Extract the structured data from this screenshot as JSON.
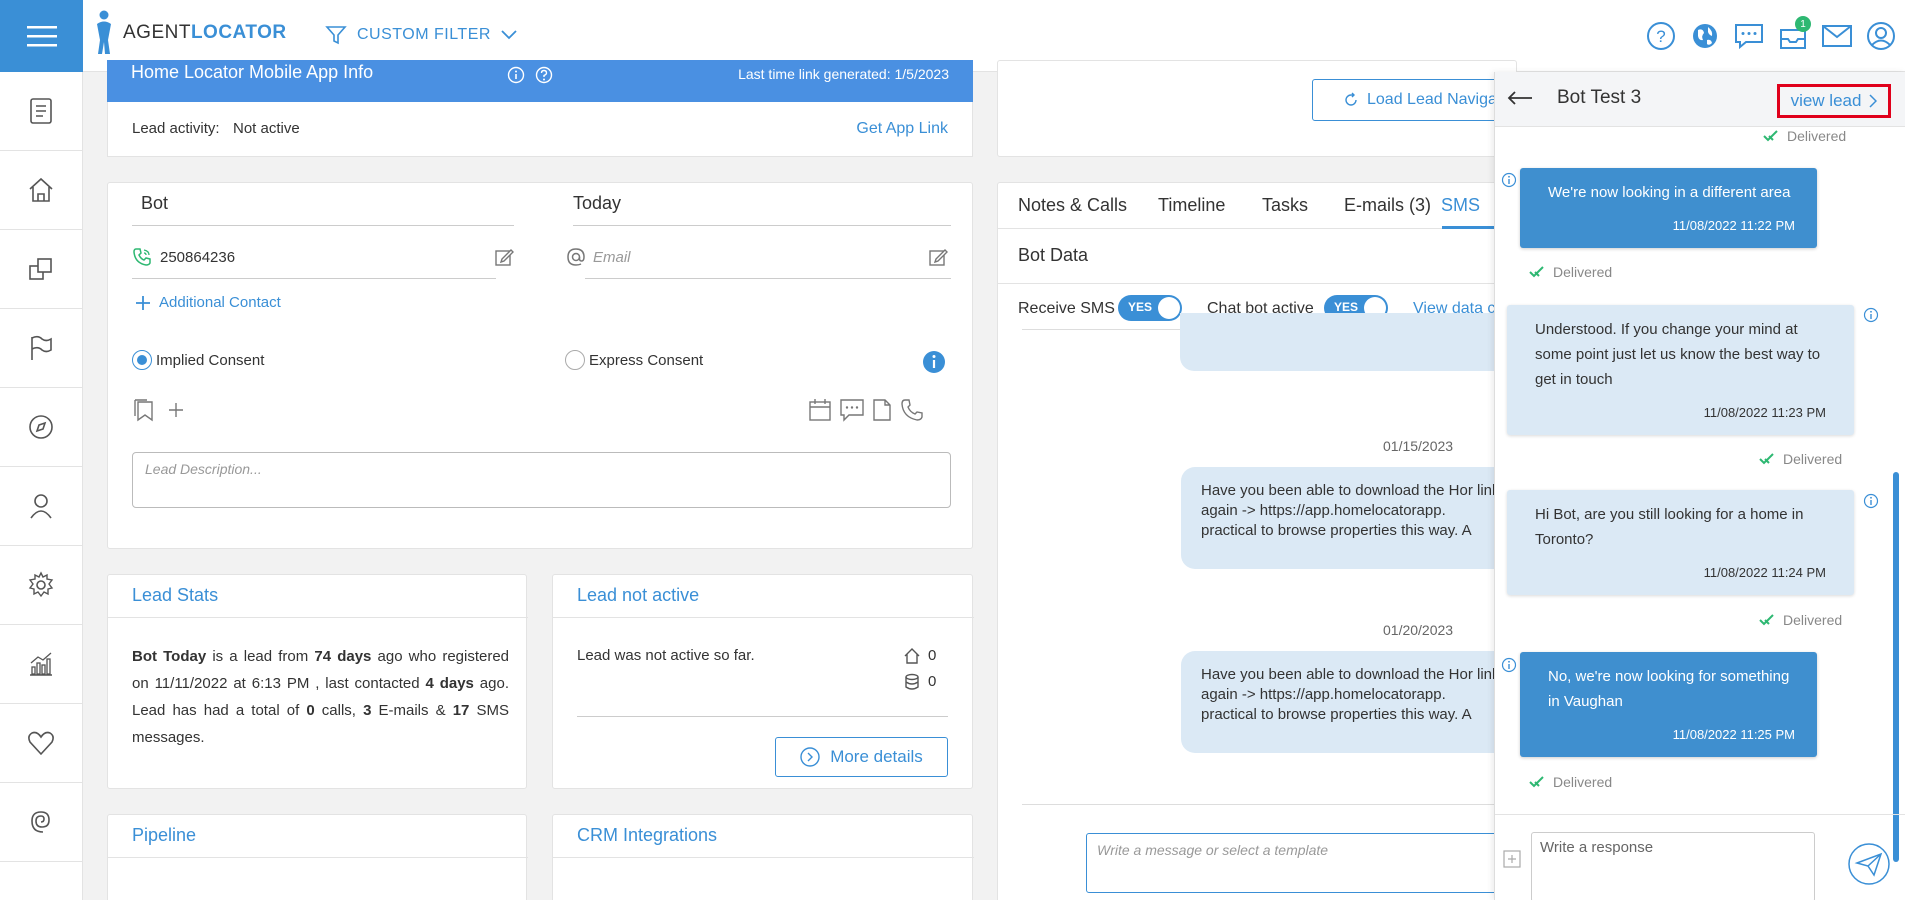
{
  "header": {
    "brand_prefix": "AGENT",
    "brand_suffix": "LOCATOR",
    "filter_label": "CUSTOM FILTER",
    "notification_count": "1"
  },
  "app_info": {
    "title": "Home Locator Mobile App Info",
    "last_link": "Last time link generated: 1/5/2023",
    "activity_label": "Lead activity:",
    "activity_value": "Not active",
    "get_link": "Get App Link"
  },
  "contact": {
    "first_name": "Bot",
    "last_name": "Today",
    "phone": "250864236",
    "email_placeholder": "Email",
    "additional_contact": "Additional Contact",
    "implied_consent": "Implied Consent",
    "express_consent": "Express Consent",
    "description_placeholder": "Lead Description..."
  },
  "lead_stats": {
    "title": "Lead Stats",
    "s1": "Bot Today",
    "s2": " is a lead from ",
    "s3": "74 days",
    "s4": " ago who registered on 11/11/2022 at 6:13 PM , last contacted ",
    "s5": "4 days",
    "s6": " ago. Lead has had a total of ",
    "s7": "0",
    "s8": " calls, ",
    "s9": "3",
    "s10": " E-mails & ",
    "s11": "17",
    "s12": " SMS messages."
  },
  "lead_not_active": {
    "title": "Lead not active",
    "text": "Lead was not active so far.",
    "homes_count": "0",
    "db_count": "0",
    "more_details": "More details"
  },
  "pipeline": {
    "title": "Pipeline"
  },
  "crm": {
    "title": "CRM Integrations"
  },
  "right_panel": {
    "load_nav": "Load Lead Navigat",
    "tabs": [
      "Notes & Calls",
      "Timeline",
      "Tasks",
      "E-mails (3)",
      "SMS"
    ],
    "bot_data": "Bot Data",
    "receive_sms": "Receive SMS",
    "chat_bot_active": "Chat bot active",
    "toggle_yes": "YES",
    "view_data": "View data c",
    "date1": "01/15/2023",
    "date2": "01/20/2023",
    "sms_msg": "Have you been able to download the Hor link again -> https://app.homelocatorapp. practical to browse properties this way. A",
    "compose_placeholder": "Write a message or select a template"
  },
  "chat": {
    "title": "Bot Test 3",
    "view_lead": "view lead",
    "delivered": "Delivered",
    "messages": [
      {
        "text": "We're now looking in a different area",
        "time": "11/08/2022 11:22 PM"
      },
      {
        "text": "Understood. If you change your mind at some point just let us know the best way to get in touch",
        "time": "11/08/2022 11:23 PM"
      },
      {
        "text": "Hi Bot, are you still looking for a home in Toronto?",
        "time": "11/08/2022 11:24 PM"
      },
      {
        "text": "No, we're now looking for something in Vaughan",
        "time": "11/08/2022 11:25 PM"
      }
    ],
    "response_placeholder": "Write a response"
  },
  "colors": {
    "accent": "#3a8fd6",
    "header_blue": "#4a90e2",
    "highlight": "#e0001b"
  }
}
